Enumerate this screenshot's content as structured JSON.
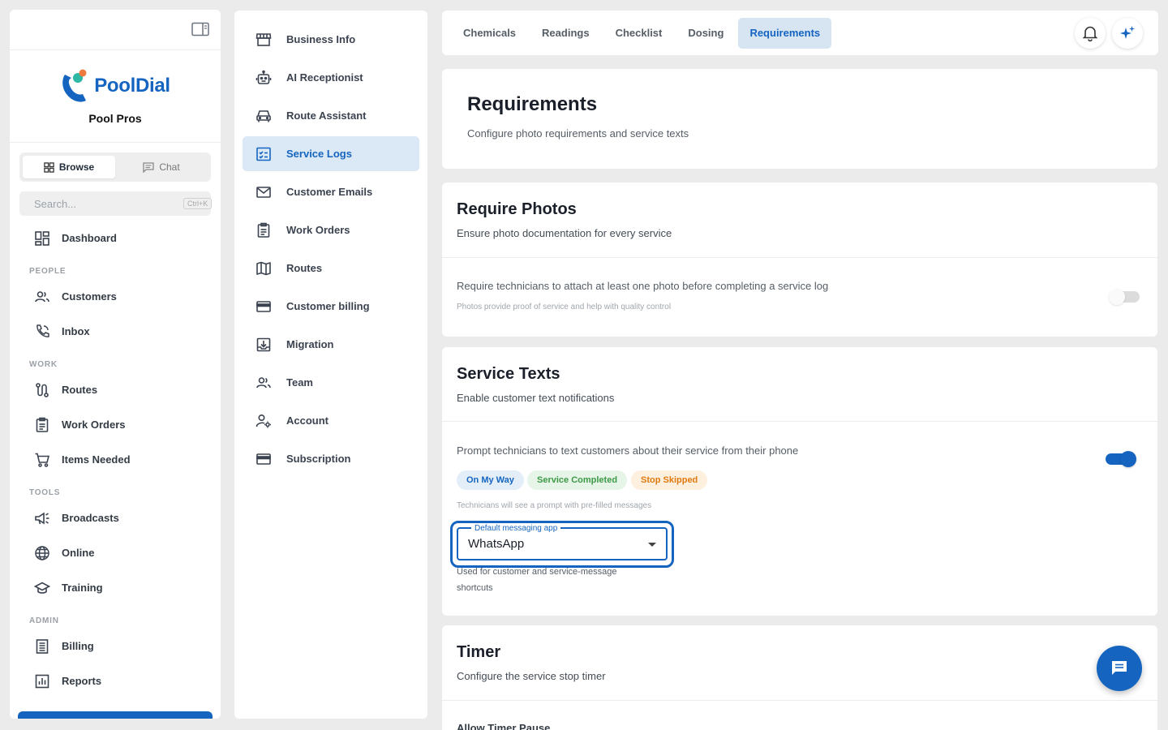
{
  "sidebar": {
    "brand_name": "PoolDial",
    "org_name": "Pool Pros",
    "segments": {
      "browse": "Browse",
      "chat": "Chat"
    },
    "search": {
      "placeholder": "Search...",
      "shortcut": "Ctrl+K"
    },
    "dashboard": "Dashboard",
    "sections": {
      "people": "PEOPLE",
      "work": "WORK",
      "tools": "TOOLS",
      "admin": "ADMIN"
    },
    "items": {
      "customers": "Customers",
      "inbox": "Inbox",
      "routes": "Routes",
      "work_orders": "Work Orders",
      "items_needed": "Items Needed",
      "broadcasts": "Broadcasts",
      "online": "Online",
      "training": "Training",
      "billing": "Billing",
      "reports": "Reports"
    }
  },
  "settings_menu": {
    "items": [
      {
        "label": "Business Info",
        "icon": "storefront-icon"
      },
      {
        "label": "AI Receptionist",
        "icon": "robot-icon"
      },
      {
        "label": "Route Assistant",
        "icon": "car-icon"
      },
      {
        "label": "Service Logs",
        "icon": "checklist-icon",
        "active": true
      },
      {
        "label": "Customer Emails",
        "icon": "mail-icon"
      },
      {
        "label": "Work Orders",
        "icon": "clipboard-icon"
      },
      {
        "label": "Routes",
        "icon": "map-icon"
      },
      {
        "label": "Customer billing",
        "icon": "credit-card-icon"
      },
      {
        "label": "Migration",
        "icon": "download-box-icon"
      },
      {
        "label": "Team",
        "icon": "people-icon"
      },
      {
        "label": "Account",
        "icon": "user-gear-icon"
      },
      {
        "label": "Subscription",
        "icon": "credit-card-icon"
      }
    ]
  },
  "tabs": [
    {
      "label": "Chemicals"
    },
    {
      "label": "Readings"
    },
    {
      "label": "Checklist"
    },
    {
      "label": "Dosing"
    },
    {
      "label": "Requirements",
      "active": true
    }
  ],
  "header": {
    "title": "Requirements",
    "subtitle": "Configure photo requirements and service texts"
  },
  "require_photos": {
    "title": "Require Photos",
    "subtitle": "Ensure photo documentation for every service",
    "option_label": "Require technicians to attach at least one photo before completing a service log",
    "option_hint": "Photos provide proof of service and help with quality control",
    "enabled": false
  },
  "service_texts": {
    "title": "Service Texts",
    "subtitle": "Enable customer text notifications",
    "option_label": "Prompt technicians to text customers about their service from their phone",
    "enabled": true,
    "chips": [
      "On My Way",
      "Service Completed",
      "Stop Skipped"
    ],
    "hint": "Technicians will see a prompt with pre-filled messages",
    "select": {
      "label": "Default messaging app",
      "value": "WhatsApp",
      "help": "Used for customer and service-message shortcuts"
    }
  },
  "timer": {
    "title": "Timer",
    "subtitle": "Configure the service stop timer",
    "option_label": "Allow Timer Pause"
  },
  "colors": {
    "accent": "#1565c0",
    "active_bg": "#dbe8f5",
    "page_bg": "#ebebeb"
  }
}
